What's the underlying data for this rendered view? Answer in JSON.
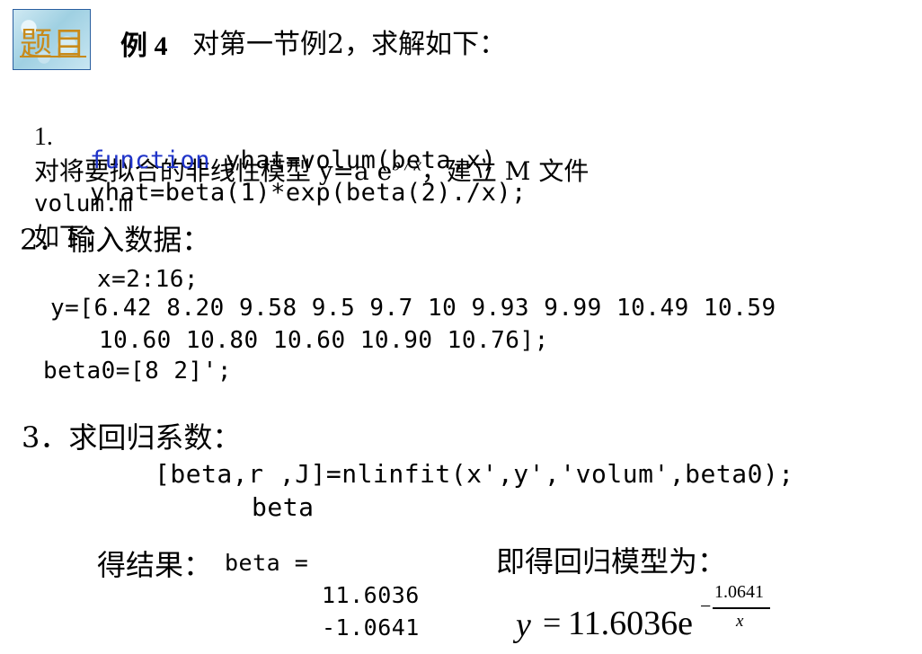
{
  "badge": {
    "label": "题目"
  },
  "example": {
    "label": "例 4",
    "text": "对第一节例2，求解如下："
  },
  "step1": {
    "number": "1.",
    "text_a": "对将要拟合的非线性模型 y=a e",
    "superscript": "b / x",
    "text_b": "，建立 M 文件",
    "filename": "volum.m",
    "text_c": "如下："
  },
  "code1": {
    "keyword": "function",
    "line1_rest": " yhat=volum(beta,x)",
    "line2": "yhat=beta(1)*exp(beta(2)./x);"
  },
  "step2": {
    "heading": "2．输入数据："
  },
  "data_code": {
    "line1": "x=2:16;",
    "line2": "y=[6.42 8.20 9.58 9.5 9.7 10 9.93 9.99 10.49 10.59",
    "line3": "10.60 10.80 10.60 10.90 10.76];",
    "line4": "beta0=[8 2]';"
  },
  "step3": {
    "heading": "3．求回归系数：",
    "code_line1": "[beta,r ,J]=nlinfit(x',y','volum',beta0);",
    "code_line2": "beta"
  },
  "result": {
    "label": "得结果：",
    "code": "beta =",
    "value1": "11.6036",
    "value2": "-1.0641"
  },
  "model": {
    "label": "即得回归模型为：",
    "lhs": "y",
    "equals": "=",
    "coef": "11.6036e",
    "sign": "−",
    "numerator": "1.0641",
    "denominator": "x"
  }
}
